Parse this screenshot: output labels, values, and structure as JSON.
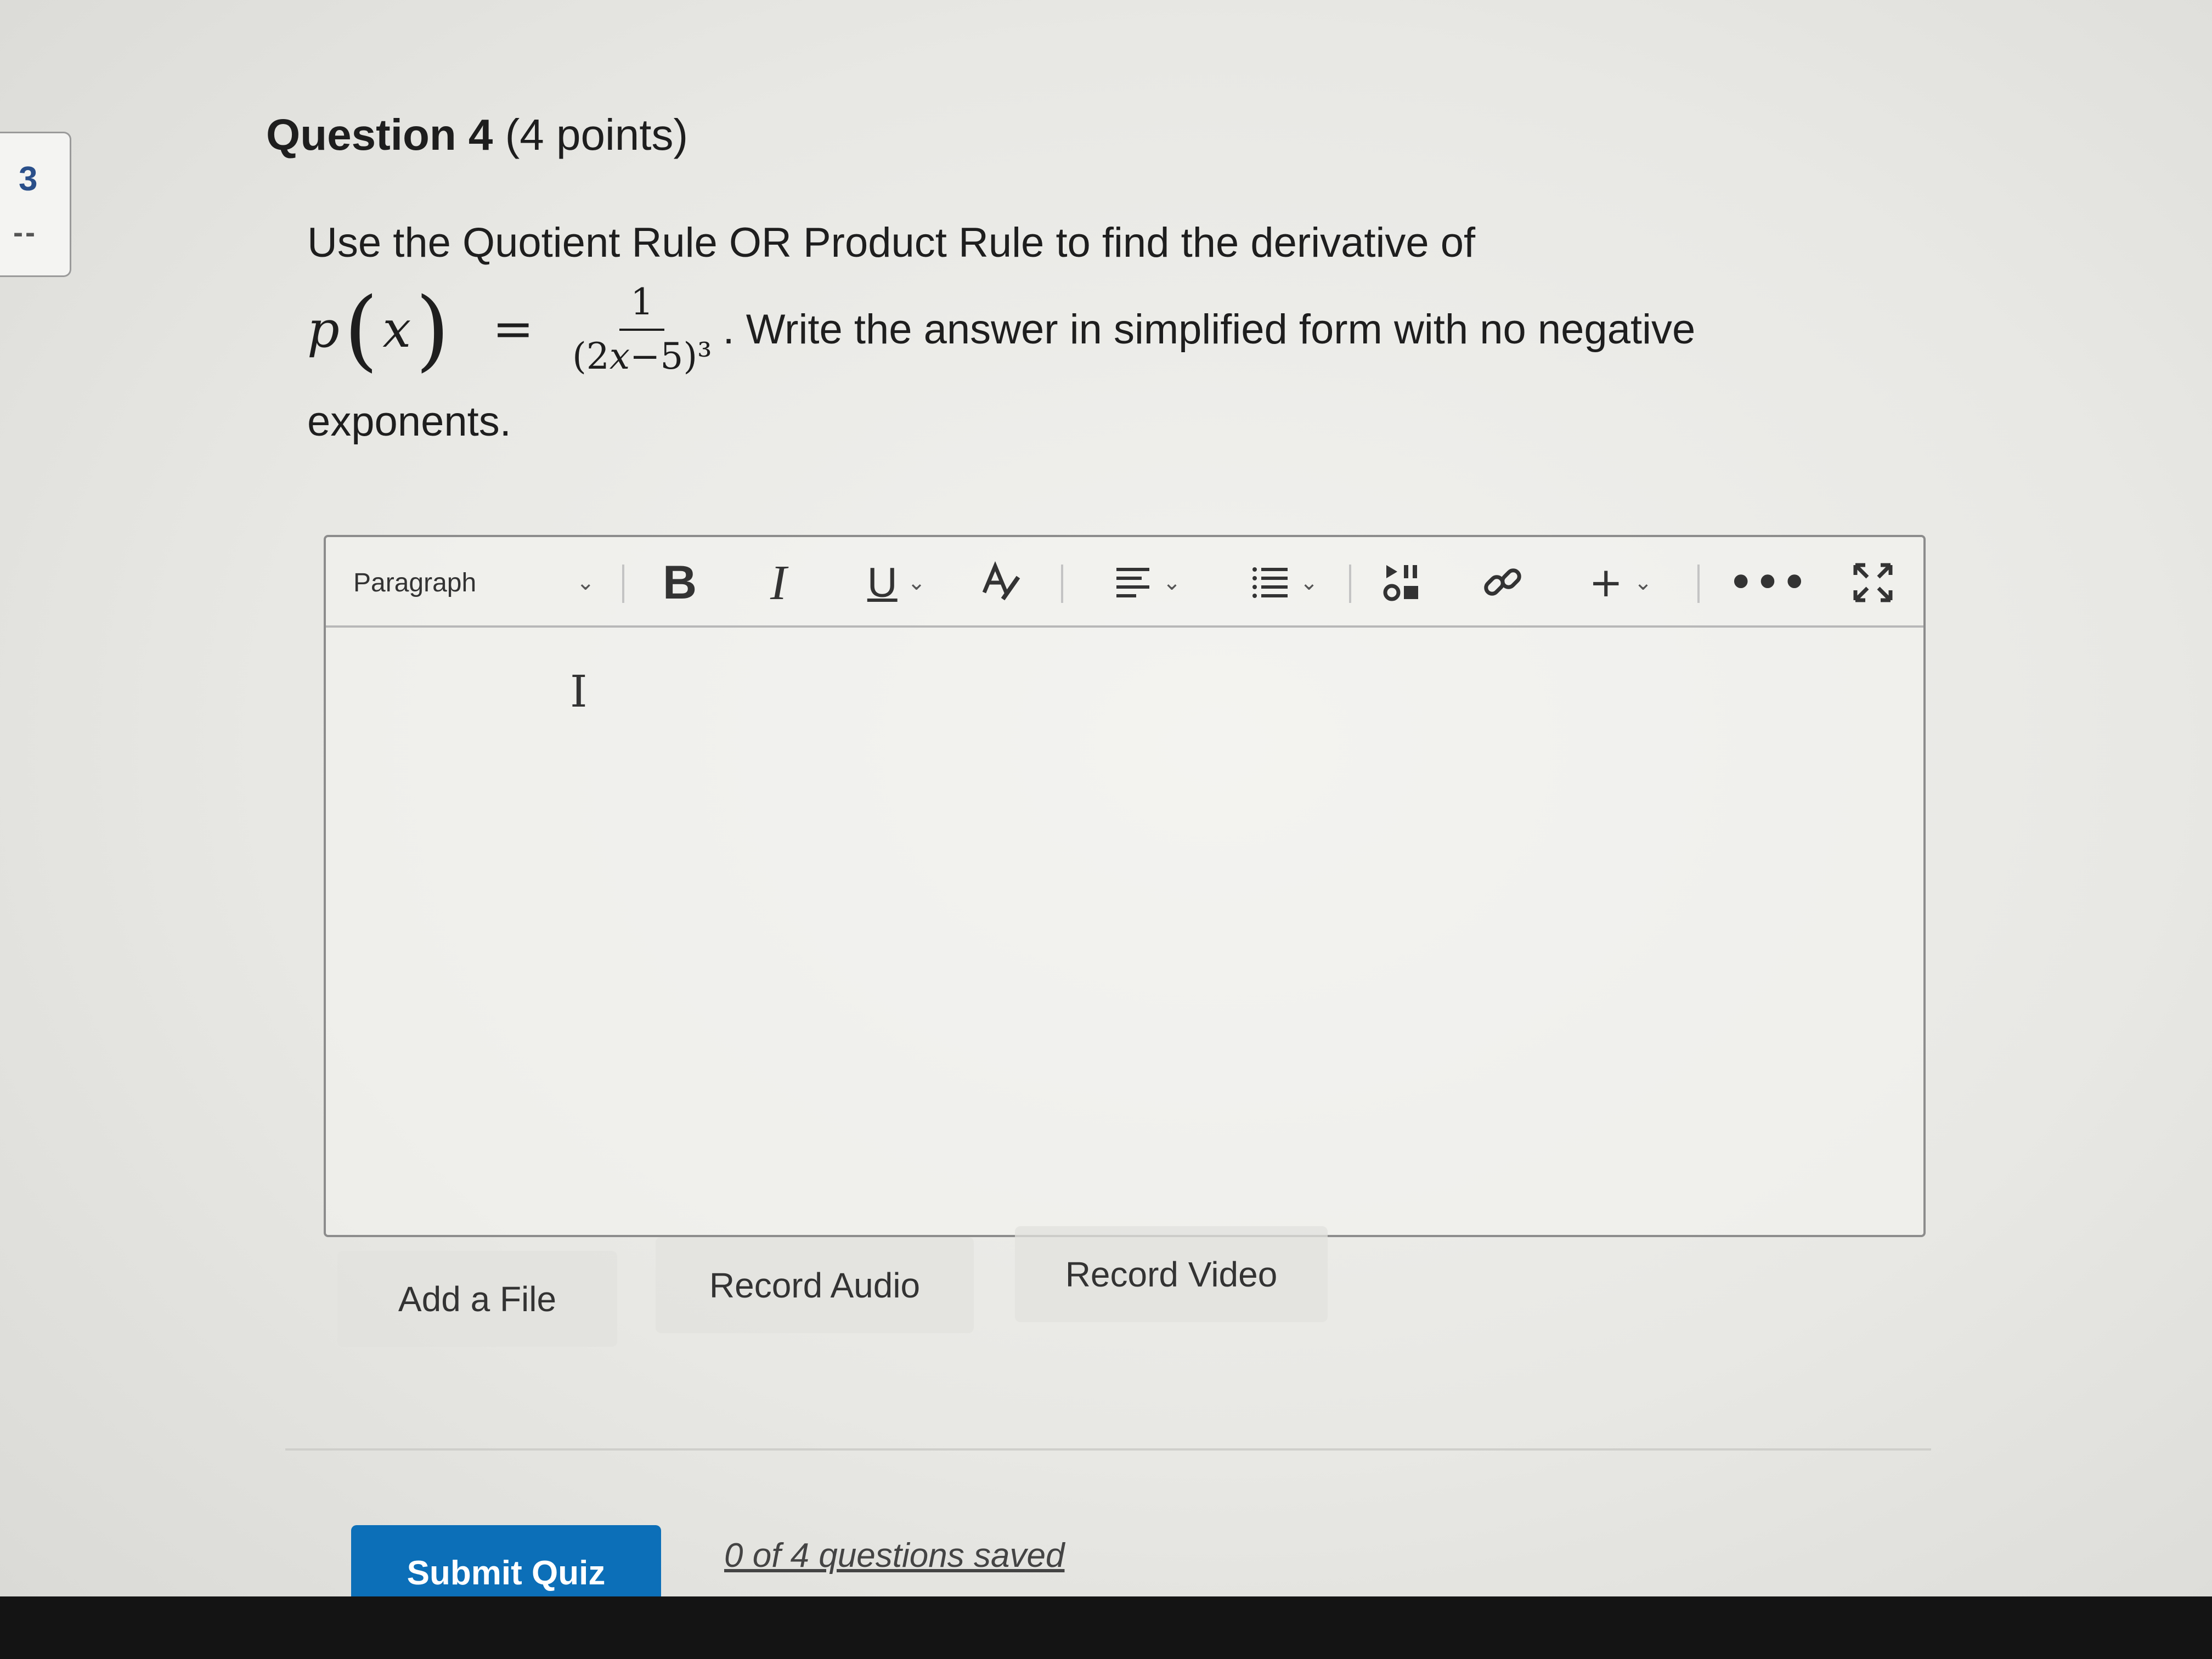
{
  "nav": {
    "question_number": "3",
    "status": "--"
  },
  "question": {
    "label": "Question 4",
    "points": "(4 points)",
    "intro": "Use the Quotient Rule OR Product Rule to find the derivative of",
    "formula": {
      "func": "p",
      "var": "x",
      "equals": "=",
      "numerator": "1",
      "den_open": "(2",
      "den_var": "x",
      "den_rest": "−5)³"
    },
    "instruction": ". Write the answer in simplified form with no negative",
    "instruction_end": "exponents."
  },
  "editor": {
    "format_label": "Paragraph",
    "bold": "B",
    "italic": "I",
    "underline": "U",
    "cursor": "I"
  },
  "icons": {
    "dropdown": "chevron-down-icon",
    "text_color": "text-color-icon",
    "align": "align-left-icon",
    "list": "bullet-list-icon",
    "media": "insert-media-icon",
    "link": "link-icon",
    "insert": "plus-icon",
    "more": "more-options-icon",
    "fullscreen": "fullscreen-icon"
  },
  "actions": {
    "add_file": "Add a File",
    "record_audio": "Record Audio",
    "record_video": "Record Video"
  },
  "footer": {
    "submit": "Submit Quiz",
    "save_status": "0 of 4 questions saved"
  },
  "colors": {
    "accent": "#0c6fb8",
    "nav_number": "#2a4f8a"
  }
}
